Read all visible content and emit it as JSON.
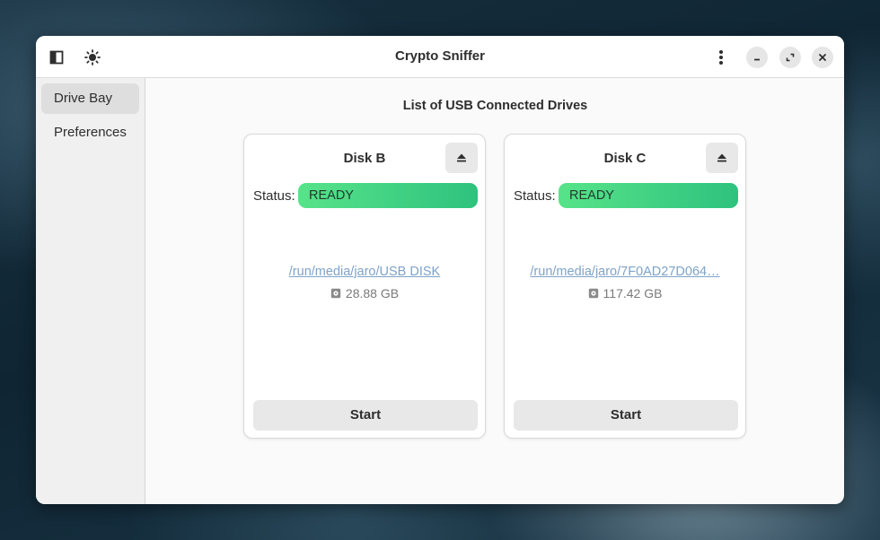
{
  "window": {
    "title": "Crypto Sniffer"
  },
  "header": {
    "sidebar_toggle_icon": "sidebar-toggle-icon",
    "theme_icon": "brightness-icon",
    "menu_icon": "vertical-dots-icon",
    "minimize_icon": "minimize-icon",
    "maximize_icon": "maximize-icon",
    "close_icon": "close-icon"
  },
  "sidebar": {
    "items": [
      {
        "label": "Drive Bay",
        "active": true
      },
      {
        "label": "Preferences",
        "active": false
      }
    ]
  },
  "main": {
    "title": "List of USB Connected Drives",
    "status_label": "Status:",
    "drives": [
      {
        "name": "Disk B",
        "status": "READY",
        "path": "/run/media/jaro/USB DISK",
        "size": "28.88 GB",
        "start_label": "Start"
      },
      {
        "name": "Disk C",
        "status": "READY",
        "path": "/run/media/jaro/7F0AD27D064…",
        "size": "117.42 GB",
        "start_label": "Start"
      }
    ]
  },
  "colors": {
    "status_ready_start": "#57e389",
    "status_ready_end": "#2ec27e",
    "link": "#7fa3c7"
  }
}
